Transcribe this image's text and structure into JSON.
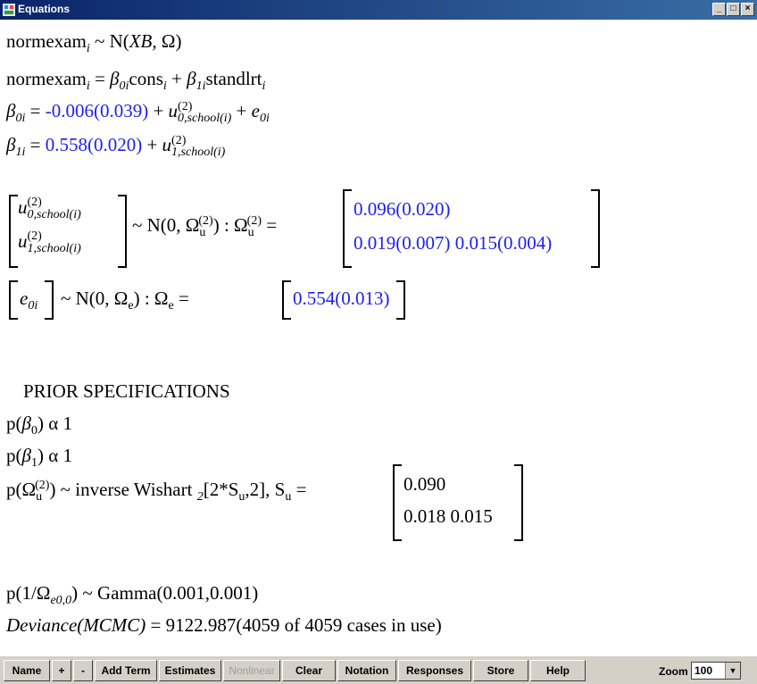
{
  "window": {
    "title": "Equations",
    "min": "_",
    "max": "□",
    "close": "×"
  },
  "eq": {
    "l1_a": "normexam",
    "l1_b": "i",
    "l1_c": " ~ N(",
    "l1_d": "XB,",
    "l1_e": " Ω)",
    "l2_a": "normexam",
    "l2_b": "i",
    "l2_c": " = ",
    "l2_d": "β",
    "l2_e": "0i",
    "l2_f": "cons",
    "l2_g": "i",
    "l2_h": " + ",
    "l2_i": "β",
    "l2_j": "1i",
    "l2_k": "standlrt",
    "l2_l": "i",
    "l3_a": "β",
    "l3_b": "0i",
    "l3_c": " = ",
    "l3_d": "-0.006(0.039)",
    "l3_e": " + ",
    "l3_f": "u",
    "l3_g": "(2)",
    "l3_h": "0,school(i)",
    "l3_i": " + ",
    "l3_j": "e",
    "l3_k": "0i",
    "l4_a": "β",
    "l4_b": "1i",
    "l4_c": " = ",
    "l4_d": "0.558(0.020)",
    "l4_e": " + ",
    "l4_f": "u",
    "l4_g": "(2)",
    "l4_h": "1,school(i)",
    "m1_u": "u",
    "m1_s": "(2)",
    "m1_0": "0,school(i)",
    "m1_1": "1,school(i)",
    "m1_dist": "~ N(0,  Ω",
    "m1_dsub": "u",
    "m1_dsup": "(2)",
    "m1_colon": ")  :  Ω",
    "m1_osub": "u",
    "m1_osup": "(2)",
    "m1_eq": " =",
    "m1_v1": "0.096(0.020)",
    "m1_v2": "0.019(0.007)  0.015(0.004)",
    "m2_e": "e",
    "m2_es": "0i",
    "m2_dist": "~ N(0,  Ω",
    "m2_dsub": "e",
    "m2_colon": ")  :  Ω",
    "m2_osub": "e",
    "m2_eq": " =",
    "m2_v": "0.554(0.013)",
    "prior_head": "PRIOR SPECIFICATIONS",
    "p1_a": "p(",
    "p1_b": "β",
    "p1_c": "0",
    "p1_d": ") α  1",
    "p2_a": "p(",
    "p2_b": "β",
    "p2_c": "1",
    "p2_d": ") α  1",
    "p3_a": "p(Ω",
    "p3_b": "u",
    "p3_c": "(2)",
    "p3_d": ") ~ inverse Wishart ",
    "p3_e": "2",
    "p3_f": "[2*S",
    "p3_g": "u",
    "p3_h": ",2],  S",
    "p3_i": "u",
    "p3_j": " =",
    "p3_v1": "0.090",
    "p3_v2": "0.018  0.015",
    "p4_a": "p(1/Ω",
    "p4_b": "e0,0",
    "p4_c": ") ~ Gamma(0.001,0.001)",
    "dev_a": "Deviance(MCMC)",
    "dev_b": " = 9122.987(4059 of 4059 cases in use)"
  },
  "toolbar": {
    "name": "Name",
    "plus": "+",
    "minus": "-",
    "add_term": "Add Term",
    "estimates": "Estimates",
    "nonlinear": "Nonlinear",
    "clear": "Clear",
    "notation": "Notation",
    "responses": "Responses",
    "store": "Store",
    "help": "Help",
    "zoom_label": "Zoom",
    "zoom_value": "100"
  },
  "colors": {
    "estimate": "#1e1ef0",
    "titlebar": "#0a246a",
    "toolbar": "#d4d0c8"
  }
}
